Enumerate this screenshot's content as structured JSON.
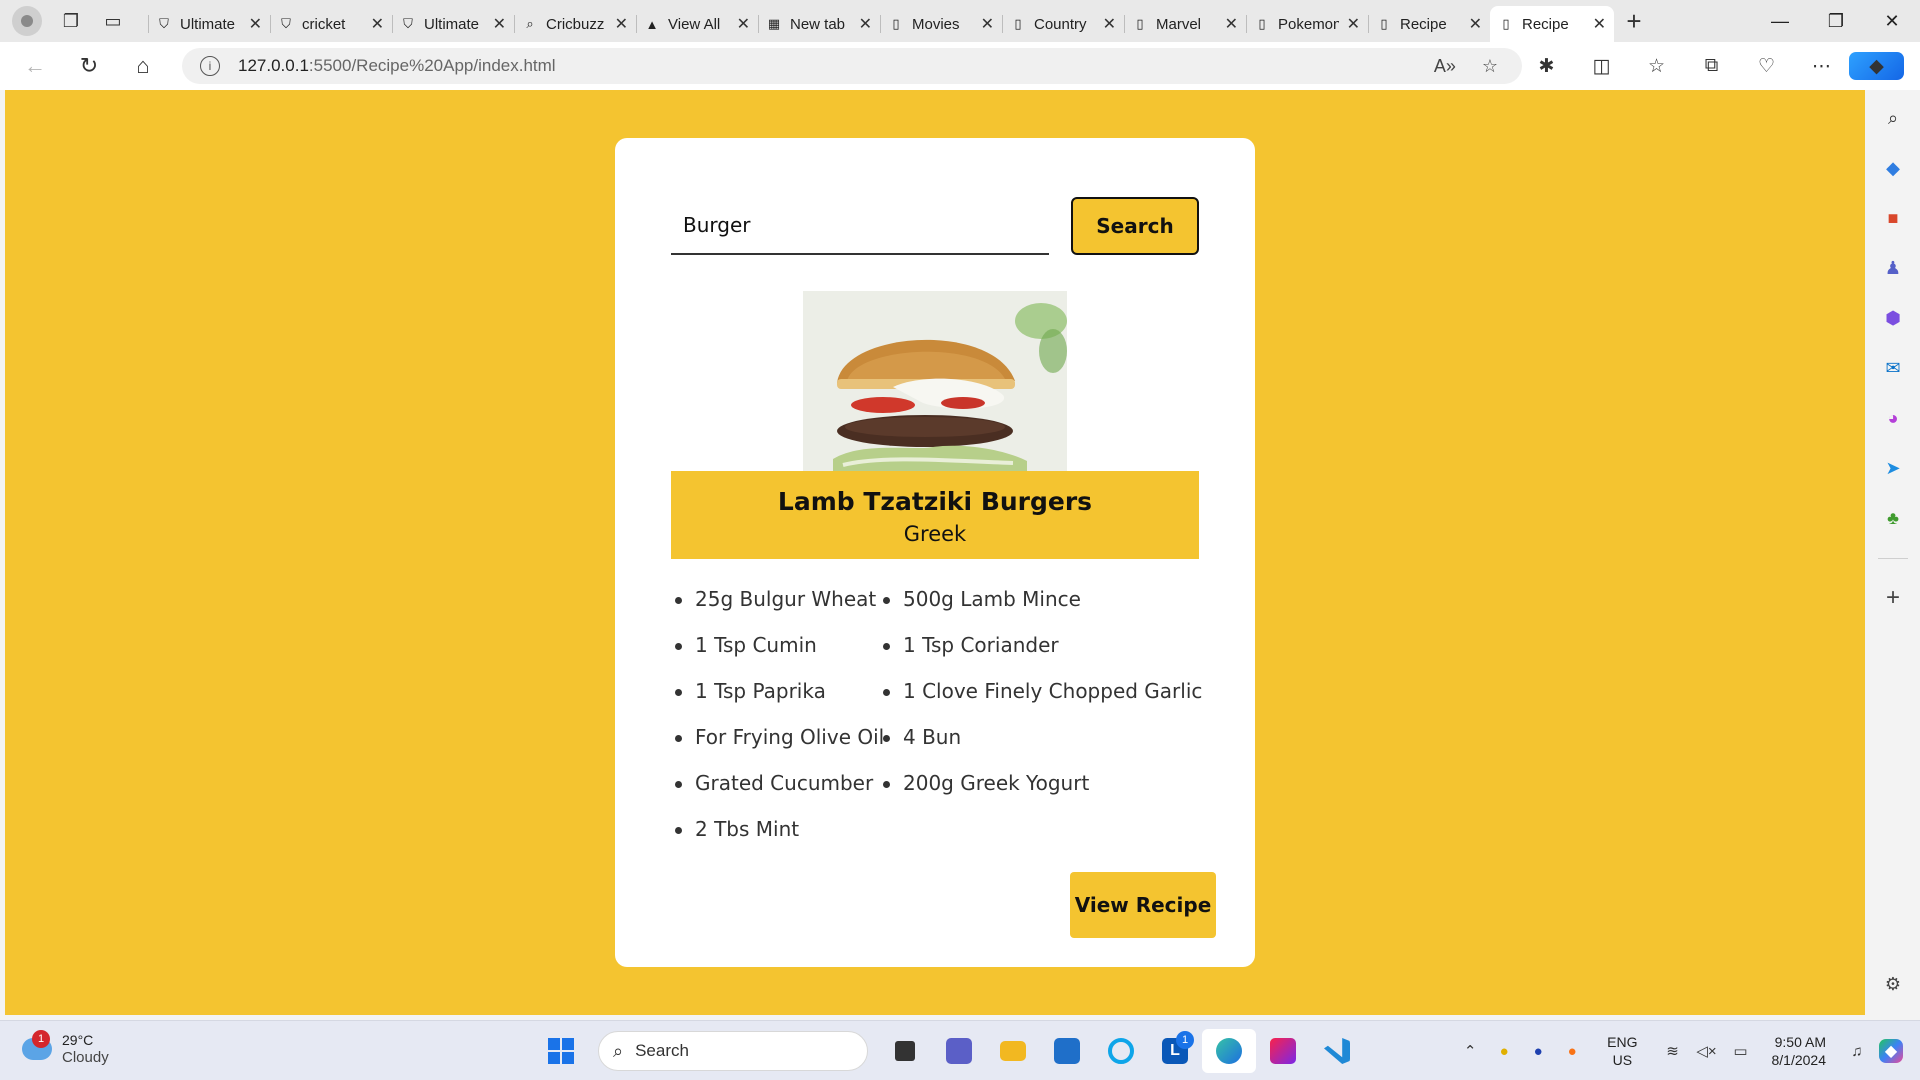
{
  "browser": {
    "tabs": [
      {
        "title": "Ultimate",
        "favicon": "shield-icon"
      },
      {
        "title": "cricket",
        "favicon": "shield-icon"
      },
      {
        "title": "Ultimate",
        "favicon": "shield-icon"
      },
      {
        "title": "Cricbuzz",
        "favicon": "search-icon"
      },
      {
        "title": "View All",
        "favicon": "app-icon"
      },
      {
        "title": "New tab",
        "favicon": "grid-icon"
      },
      {
        "title": "Movies",
        "favicon": "page-icon"
      },
      {
        "title": "Country",
        "favicon": "page-icon"
      },
      {
        "title": "Marvel",
        "favicon": "page-icon"
      },
      {
        "title": "Pokemon",
        "favicon": "page-icon"
      },
      {
        "title": "Recipe",
        "favicon": "page-icon"
      },
      {
        "title": "Recipe",
        "favicon": "page-icon",
        "active": true
      }
    ],
    "address": {
      "host": "127.0.0.1",
      "path": ":5500/Recipe%20App/index.html"
    }
  },
  "app": {
    "search": {
      "value": "Burger",
      "button_label": "Search"
    },
    "meal": {
      "name": "Lamb Tzatziki Burgers",
      "area": "Greek",
      "ingredients": [
        "25g Bulgur Wheat",
        "1 Tsp Cumin",
        "1 Tsp Paprika",
        "For Frying Olive Oil",
        "Grated Cucumber",
        "2 Tbs Mint",
        "500g Lamb Mince",
        "1 Tsp Coriander",
        "1 Clove Finely Chopped Garlic",
        "4 Bun",
        "200g Greek Yogurt"
      ],
      "view_button_label": "View Recipe"
    },
    "colors": {
      "accent": "#f4c430",
      "card": "#ffffff"
    }
  },
  "taskbar": {
    "weather": {
      "temp": "29°C",
      "condition": "Cloudy",
      "badge": "1"
    },
    "search_placeholder": "Search",
    "lang": {
      "line1": "ENG",
      "line2": "US"
    },
    "clock": {
      "time": "9:50 AM",
      "date": "8/1/2024"
    },
    "notification_badge": "1"
  }
}
